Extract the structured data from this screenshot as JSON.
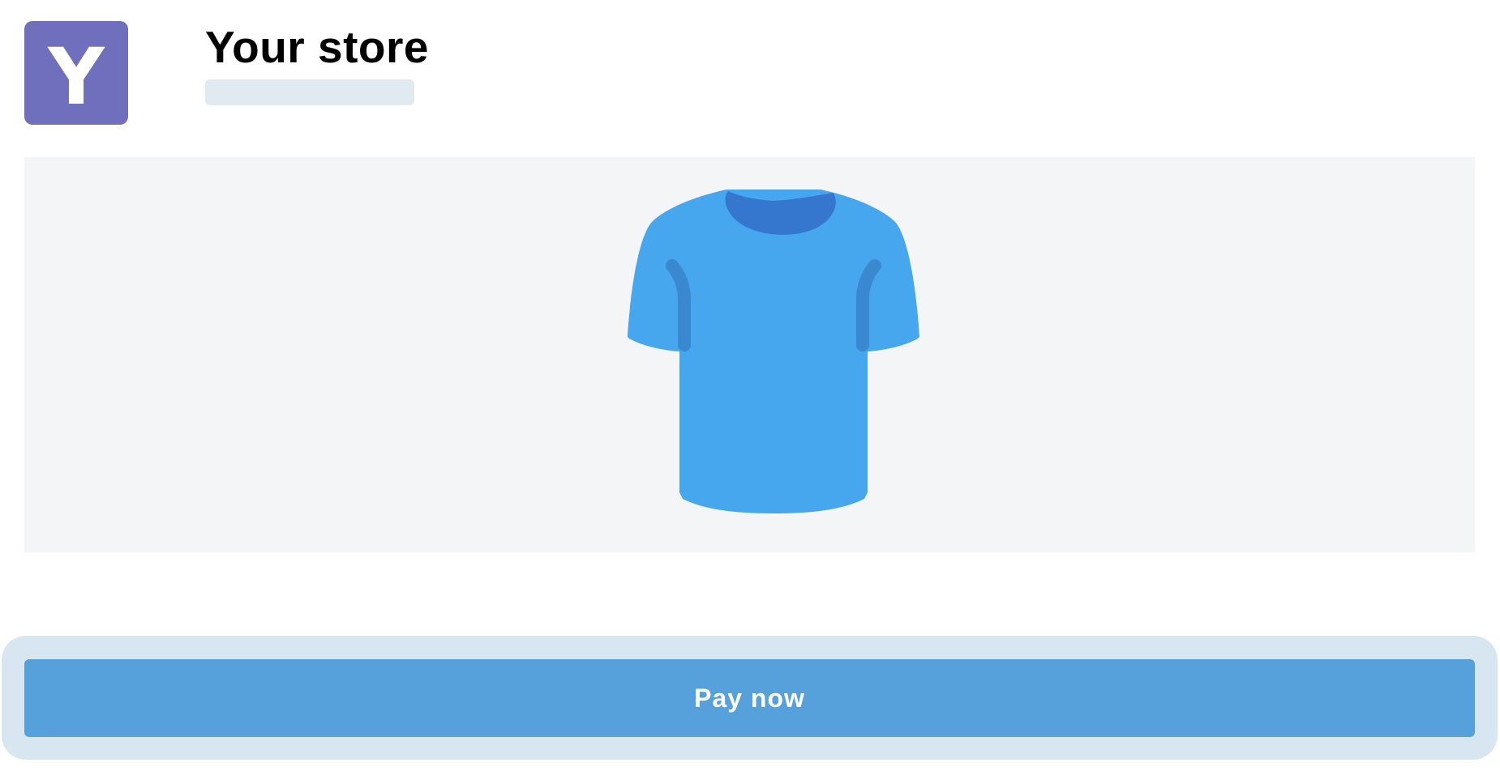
{
  "store": {
    "logo_letter": "Y",
    "title": "Your store"
  },
  "product": {
    "image": "blue-tshirt",
    "colors": {
      "shirt": "#47a7ee",
      "collar": "#3577cf",
      "seams": "#3a88d0",
      "logo_bg": "#6f6fbd",
      "pay_button": "#56a1db"
    }
  },
  "checkout": {
    "pay_label": "Pay now"
  }
}
